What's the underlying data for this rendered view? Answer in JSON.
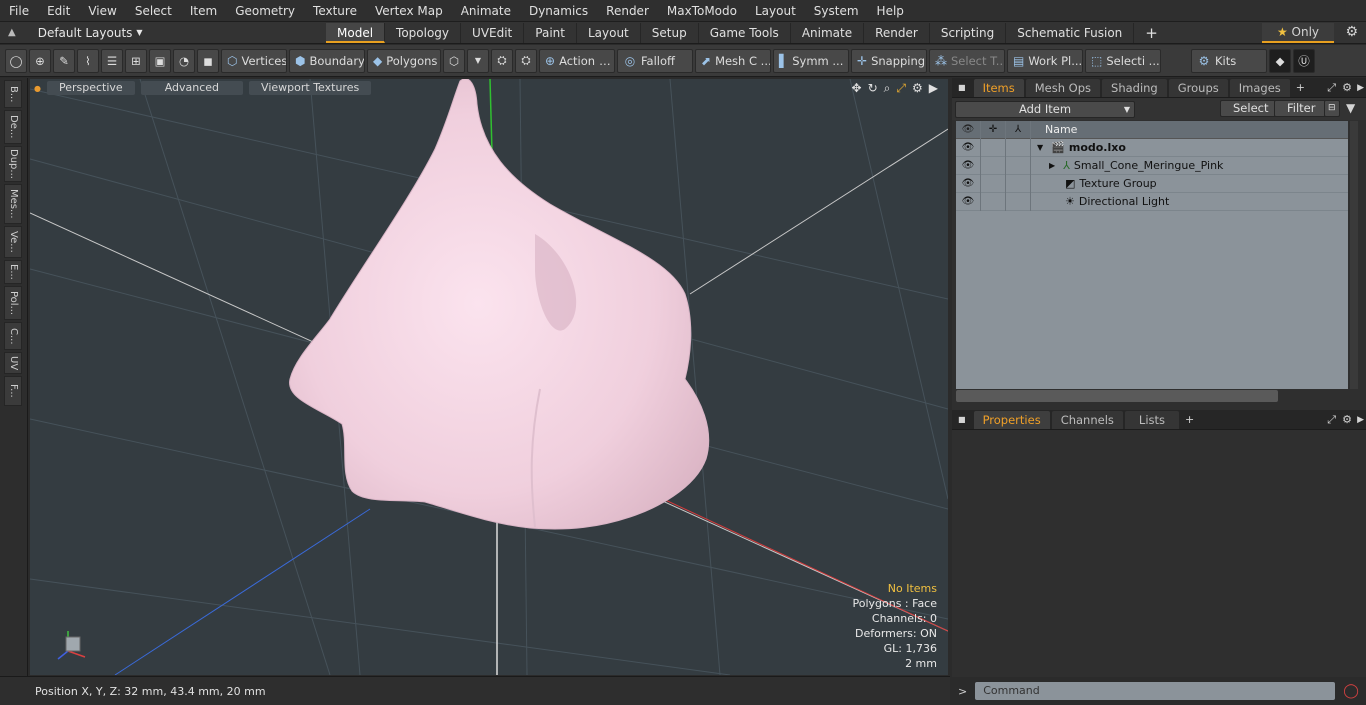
{
  "menu": [
    "File",
    "Edit",
    "View",
    "Select",
    "Item",
    "Geometry",
    "Texture",
    "Vertex Map",
    "Animate",
    "Dynamics",
    "Render",
    "MaxToModo",
    "Layout",
    "System",
    "Help"
  ],
  "layout_selector": "Default Layouts",
  "tabs": [
    "Model",
    "Topology",
    "UVEdit",
    "Paint",
    "Layout",
    "Setup",
    "Game Tools",
    "Animate",
    "Render",
    "Scripting",
    "Schematic Fusion"
  ],
  "active_tab": "Model",
  "only_label": "Only",
  "toolbar": {
    "vertices": "Vertices",
    "boundary": "Boundary",
    "polygons": "Polygons",
    "action": "Action",
    "falloff": "Falloff",
    "meshc": "Mesh C ...",
    "symm": "Symm ...",
    "snapping": "Snapping",
    "selectt": "Select T...",
    "workpl": "Work Pl...",
    "selecti": "Selecti ...",
    "kits": "Kits"
  },
  "left_tabs": [
    "B...",
    "De...",
    "Dup...",
    "Mes...",
    "Ve...",
    "E...",
    "Pol...",
    "C...",
    "UV",
    "F..."
  ],
  "viewport": {
    "perspective": "Perspective",
    "advanced": "Advanced",
    "textures": "Viewport Textures"
  },
  "info": {
    "no_items": "No Items",
    "polygons": "Polygons : Face",
    "channels": "Channels: 0",
    "deformers": "Deformers: ON",
    "gl": "GL: 1,736",
    "scale": "2 mm"
  },
  "status": "Position X, Y, Z:  32 mm, 43.4 mm, 20 mm",
  "panel_tabs": [
    "Items",
    "Mesh Ops",
    "Shading",
    "Groups",
    "Images"
  ],
  "add_item": "Add Item",
  "select_btn": "Select",
  "filter_btn": "Filter",
  "name_col": "Name",
  "tree": [
    "modo.lxo",
    "Small_Cone_Meringue_Pink",
    "Texture Group",
    "Directional Light"
  ],
  "props_tabs": [
    "Properties",
    "Channels",
    "Lists"
  ],
  "command_placeholder": "Command"
}
